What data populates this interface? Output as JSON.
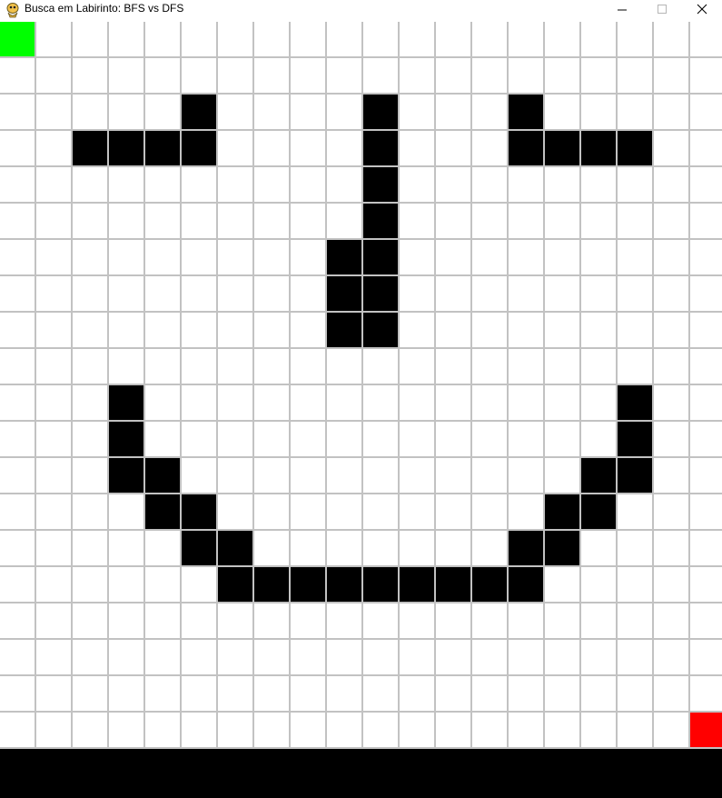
{
  "window": {
    "title": "Busca em Labirinto: BFS vs DFS",
    "icon": "pygame-snake-icon",
    "controls": [
      "minimize-icon",
      "maximize-icon",
      "close-icon"
    ]
  },
  "maze": {
    "rows": 20,
    "cols": 20,
    "colors": {
      "empty": "#ffffff",
      "wall": "#000000",
      "start": "#00ff00",
      "goal": "#ff0000",
      "gridline": "#c2c2c2"
    },
    "start": [
      0,
      0
    ],
    "goal": [
      19,
      19
    ],
    "walls": [
      [
        2,
        5
      ],
      [
        2,
        10
      ],
      [
        2,
        14
      ],
      [
        3,
        2
      ],
      [
        3,
        3
      ],
      [
        3,
        4
      ],
      [
        3,
        5
      ],
      [
        3,
        10
      ],
      [
        3,
        14
      ],
      [
        3,
        15
      ],
      [
        3,
        16
      ],
      [
        3,
        17
      ],
      [
        4,
        10
      ],
      [
        5,
        10
      ],
      [
        6,
        9
      ],
      [
        6,
        10
      ],
      [
        7,
        9
      ],
      [
        7,
        10
      ],
      [
        8,
        9
      ],
      [
        8,
        10
      ],
      [
        10,
        3
      ],
      [
        10,
        17
      ],
      [
        11,
        3
      ],
      [
        11,
        17
      ],
      [
        12,
        3
      ],
      [
        12,
        4
      ],
      [
        12,
        16
      ],
      [
        12,
        17
      ],
      [
        13,
        4
      ],
      [
        13,
        5
      ],
      [
        13,
        15
      ],
      [
        13,
        16
      ],
      [
        14,
        5
      ],
      [
        14,
        6
      ],
      [
        14,
        14
      ],
      [
        14,
        15
      ],
      [
        15,
        6
      ],
      [
        15,
        7
      ],
      [
        15,
        8
      ],
      [
        15,
        9
      ],
      [
        15,
        10
      ],
      [
        15,
        11
      ],
      [
        15,
        12
      ],
      [
        15,
        13
      ],
      [
        15,
        14
      ]
    ]
  }
}
